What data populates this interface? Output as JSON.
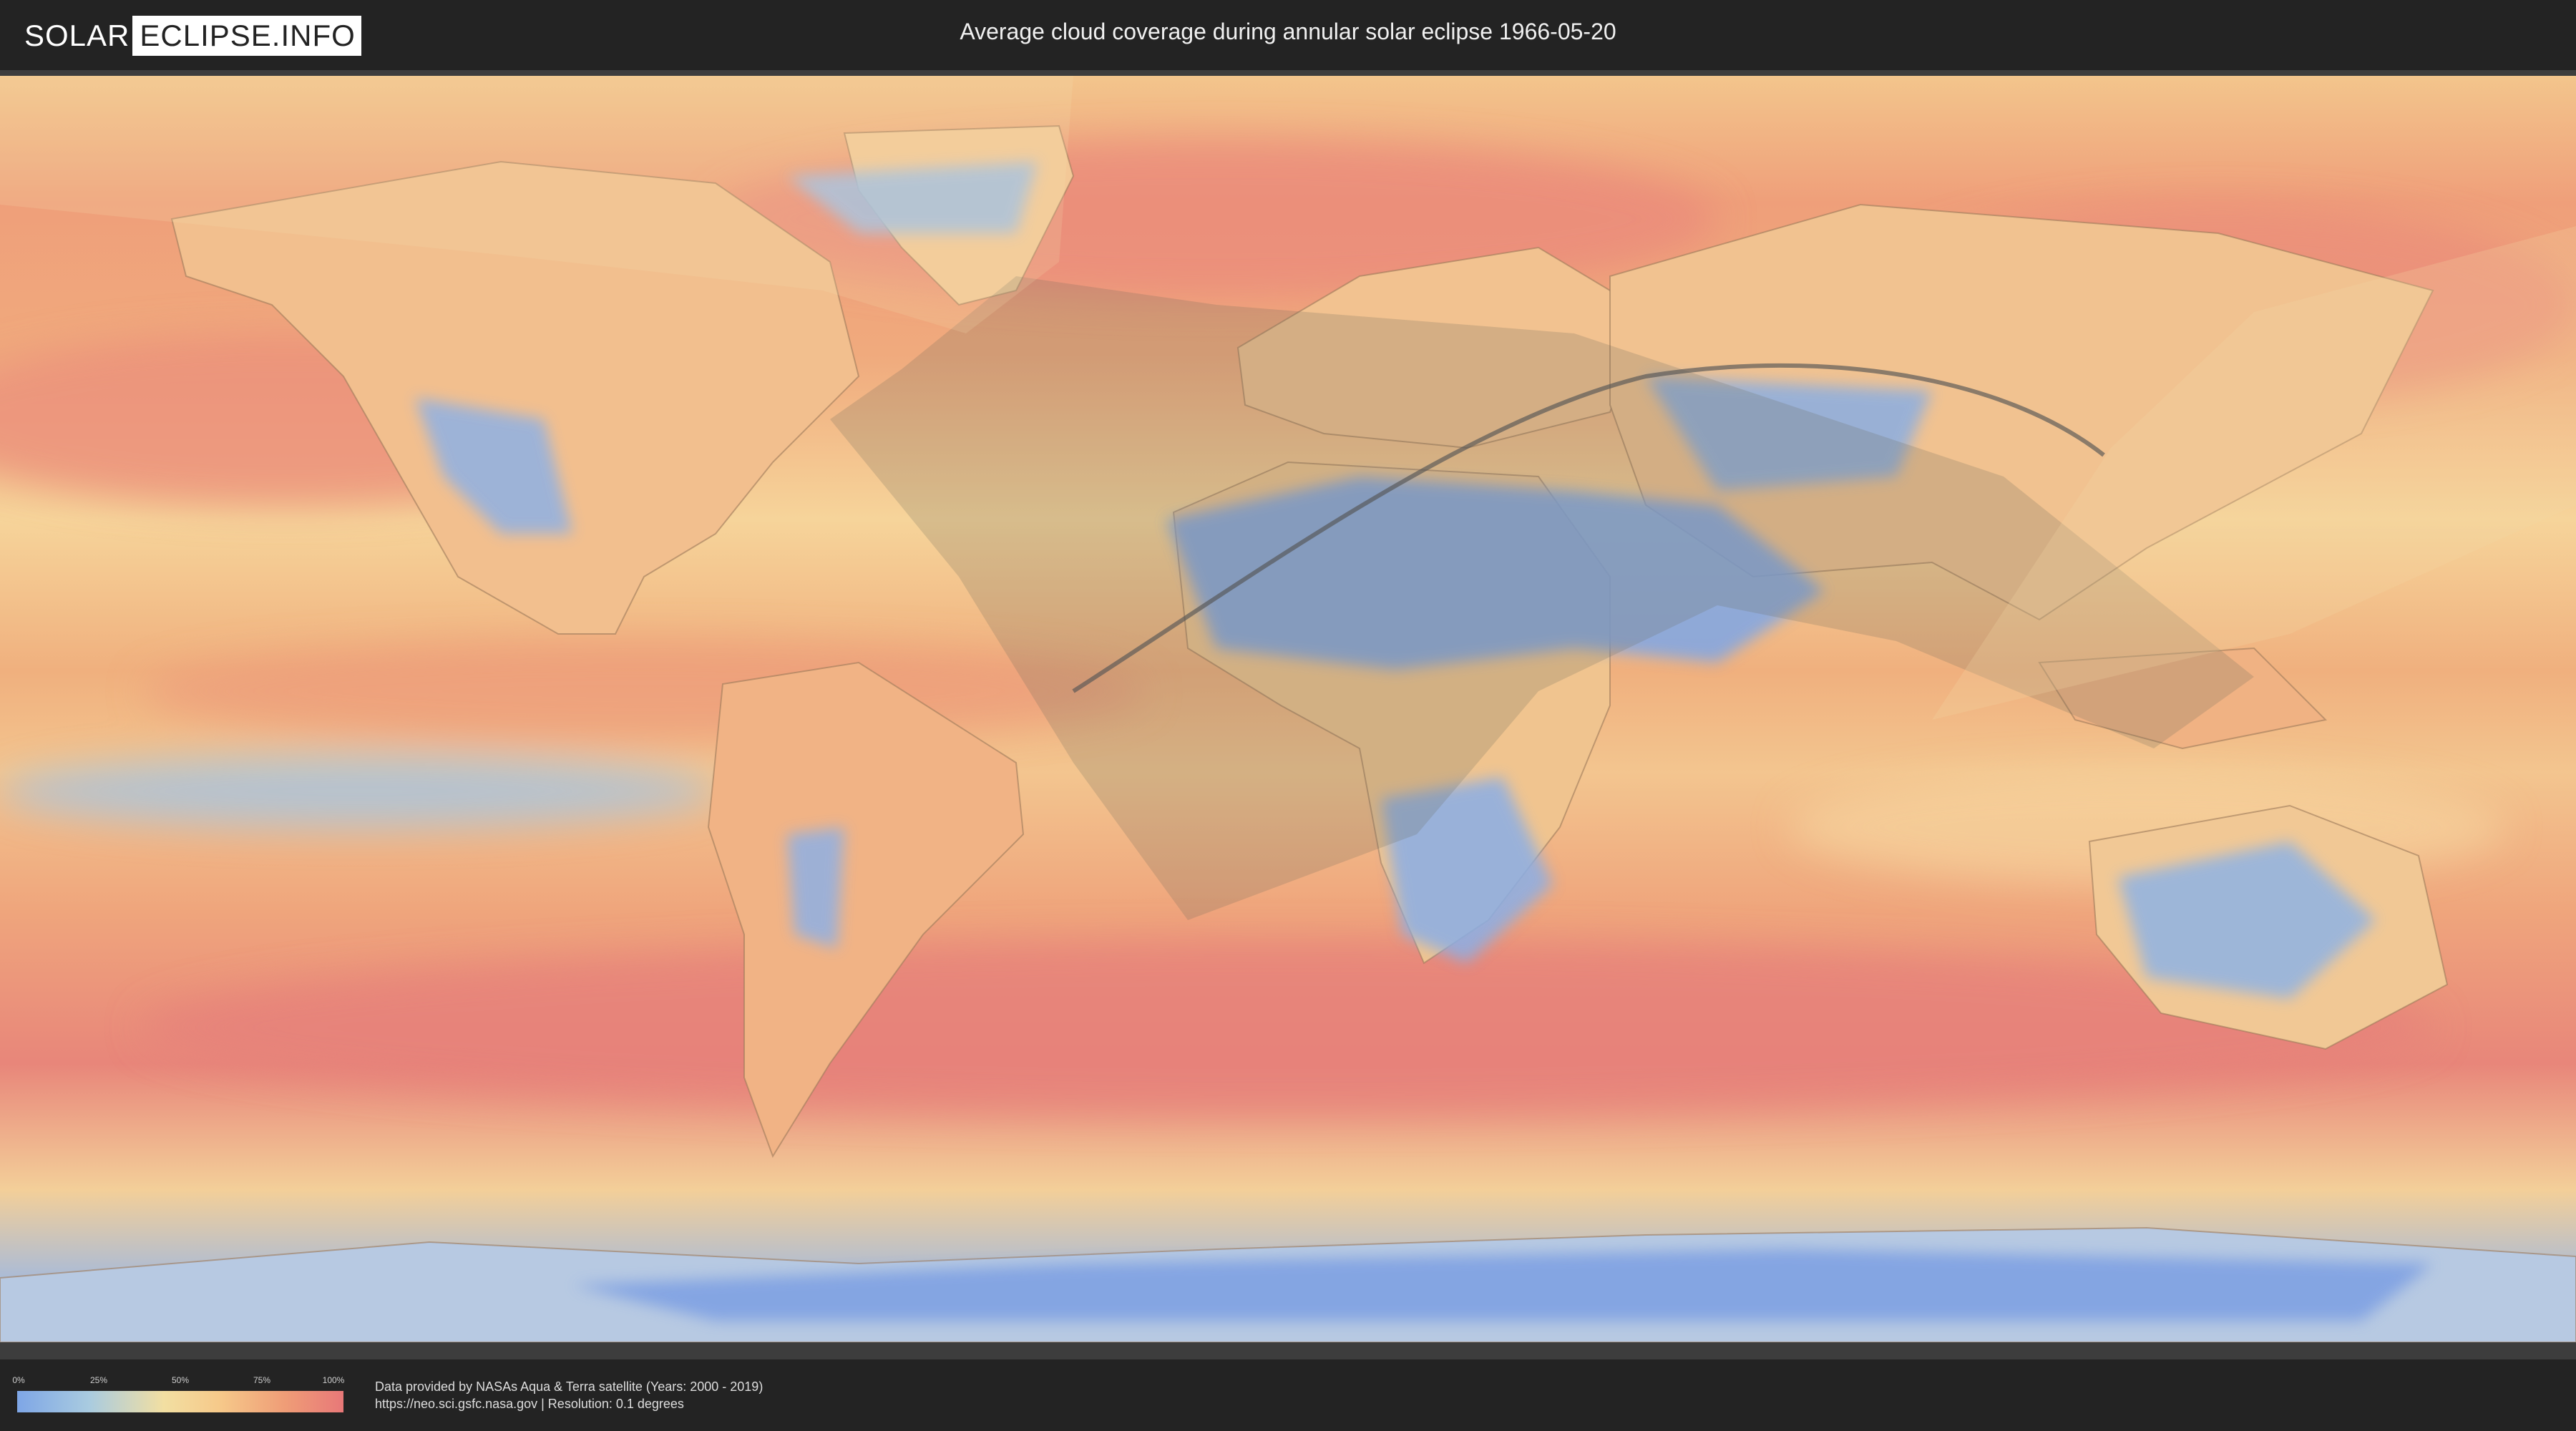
{
  "header": {
    "logo_part1": "SOLAR",
    "logo_part2": "ECLIPSE.INFO",
    "title": "Average cloud coverage during annular solar eclipse 1966-05-20"
  },
  "legend": {
    "ticks": [
      "0%",
      "25%",
      "50%",
      "75%",
      "100%"
    ],
    "tick_fractions": [
      0,
      0.25,
      0.5,
      0.75,
      1
    ],
    "colors": [
      "#7ea6e6",
      "#a9cbe0",
      "#f2dfa2",
      "#ef9d77",
      "#e87878"
    ]
  },
  "footer": {
    "credit_line1": "Data provided by NASAs Aqua & Terra satellite (Years: 2000 - 2019)",
    "credit_line2": "https://neo.sci.gsfc.nasa.gov | Resolution: 0.1 degrees"
  },
  "map": {
    "projection": "equirectangular",
    "layer": "average cloud coverage",
    "overlays": [
      "eclipse penumbra shadow",
      "annularity path"
    ],
    "colors": {
      "clear": "#7ea6e6",
      "medium": "#f3d79b",
      "cloudy": "#e8867a",
      "shadow": "#6a6a5a",
      "path": "#555555"
    }
  }
}
